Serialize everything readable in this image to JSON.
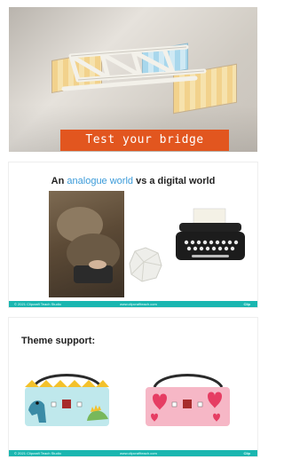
{
  "slides": [
    {
      "caption": "Test your bridge"
    },
    {
      "title_prefix": "An ",
      "title_highlight": "analogue world",
      "title_suffix": " vs a digital world",
      "footer_left": "© 2021 Clipcraft Teach Studio",
      "footer_mid": "www.clipcraftteach.com",
      "footer_right": "Clip"
    },
    {
      "title": "Theme support:",
      "footer_left": "© 2021 Clipcraft Teach Studio",
      "footer_mid": "www.clipcraftteach.com",
      "footer_right": "Clip"
    }
  ],
  "colors": {
    "caption_bg": "#e2561f",
    "highlight": "#3a9ad9",
    "footer": "#1ab6b0",
    "dino_theme_bg": "#bfe8ec",
    "heart_theme_bg": "#f6b7c6"
  }
}
